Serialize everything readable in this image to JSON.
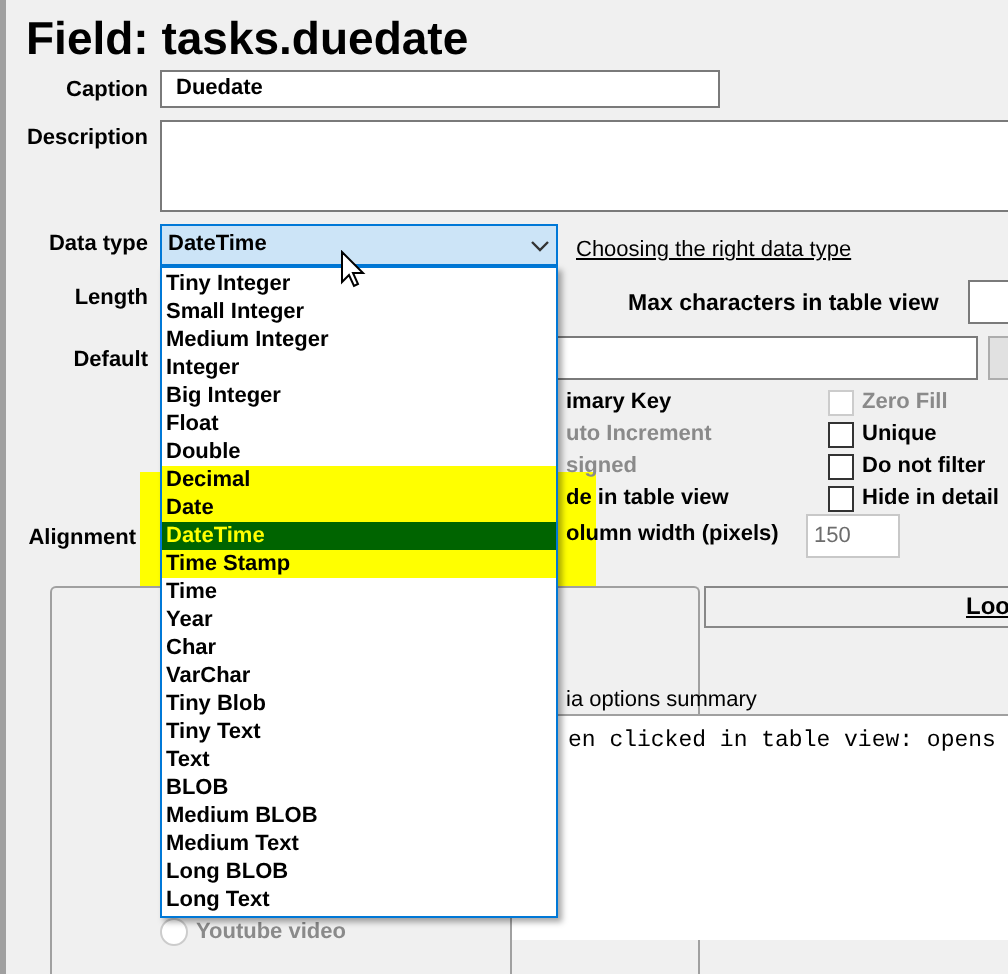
{
  "title": "Field: tasks.duedate",
  "caption": {
    "label": "Caption",
    "value": "Duedate"
  },
  "description": {
    "label": "Description"
  },
  "data_type": {
    "label": "Data type",
    "value": "DateTime",
    "link": "Choosing the right data type"
  },
  "length": {
    "label": "Length"
  },
  "max_chars": {
    "label": "Max characters in table view"
  },
  "default": {
    "label": "Default"
  },
  "alignment": {
    "label": "Alignment"
  },
  "left_options": [
    {
      "label": "imary Key",
      "disabled": false
    },
    {
      "label": "uto Increment",
      "disabled": true
    },
    {
      "label": "signed",
      "disabled": true
    },
    {
      "label": "de in table view",
      "disabled": false
    }
  ],
  "right_options": [
    {
      "label": "Zero Fill",
      "checked": false,
      "disabled": true
    },
    {
      "label": "Unique",
      "checked": false,
      "disabled": false
    },
    {
      "label": "Do not filter",
      "checked": false,
      "disabled": false
    },
    {
      "label": "Hide in detail",
      "checked": false,
      "disabled": false
    }
  ],
  "column_width": {
    "label": "olumn width (pixels)",
    "value": "150",
    "disabled": true
  },
  "tab": {
    "label": "Loo"
  },
  "media": {
    "label": "Youtube video",
    "selected": false,
    "disabled": true
  },
  "summary": {
    "heading": "ia options summary",
    "text": "en clicked in table view: opens"
  },
  "dropdown": [
    {
      "label": "Tiny Integer",
      "selected": false,
      "highlighted": false
    },
    {
      "label": "Small Integer",
      "selected": false,
      "highlighted": false
    },
    {
      "label": "Medium Integer",
      "selected": false,
      "highlighted": false
    },
    {
      "label": "Integer",
      "selected": false,
      "highlighted": false
    },
    {
      "label": "Big Integer",
      "selected": false,
      "highlighted": false
    },
    {
      "label": "Float",
      "selected": false,
      "highlighted": false
    },
    {
      "label": "Double",
      "selected": false,
      "highlighted": false
    },
    {
      "label": "Decimal",
      "selected": false,
      "highlighted": true
    },
    {
      "label": "Date",
      "selected": false,
      "highlighted": true
    },
    {
      "label": "DateTime",
      "selected": true,
      "highlighted": true
    },
    {
      "label": "Time Stamp",
      "selected": false,
      "highlighted": true
    },
    {
      "label": "Time",
      "selected": false,
      "highlighted": false
    },
    {
      "label": "Year",
      "selected": false,
      "highlighted": false
    },
    {
      "label": "Char",
      "selected": false,
      "highlighted": false
    },
    {
      "label": "VarChar",
      "selected": false,
      "highlighted": false
    },
    {
      "label": "Tiny Blob",
      "selected": false,
      "highlighted": false
    },
    {
      "label": "Tiny Text",
      "selected": false,
      "highlighted": false
    },
    {
      "label": "Text",
      "selected": false,
      "highlighted": false
    },
    {
      "label": "BLOB",
      "selected": false,
      "highlighted": false
    },
    {
      "label": "Medium BLOB",
      "selected": false,
      "highlighted": false
    },
    {
      "label": "Medium Text",
      "selected": false,
      "highlighted": false
    },
    {
      "label": "Long BLOB",
      "selected": false,
      "highlighted": false
    },
    {
      "label": "Long Text",
      "selected": false,
      "highlighted": false
    }
  ]
}
